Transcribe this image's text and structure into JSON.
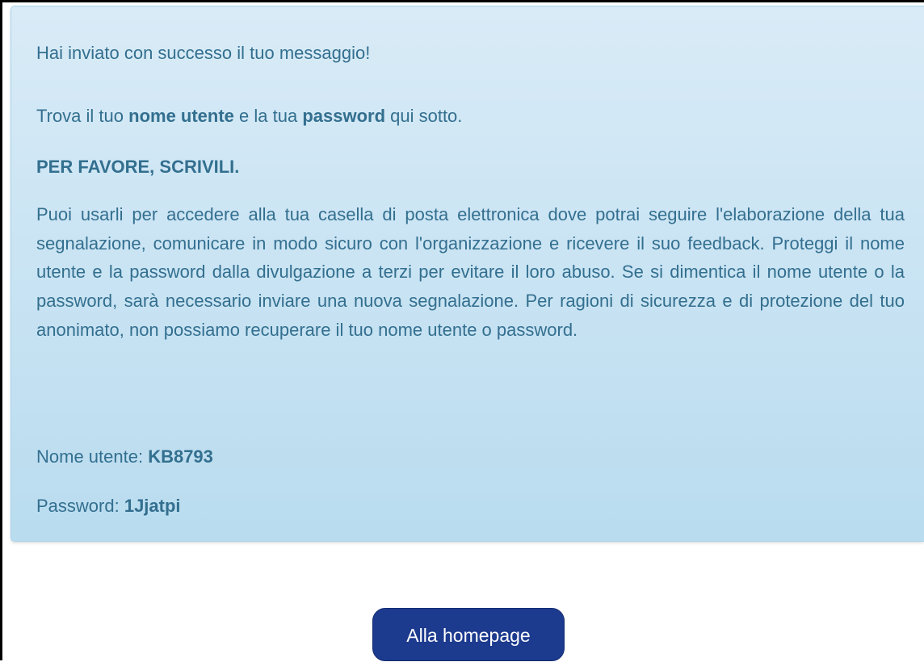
{
  "alert": {
    "success_message": "Hai inviato con successo il tuo messaggio!",
    "find_prefix": "Trova il tuo ",
    "find_username_bold": "nome utente",
    "find_middle": " e la tua ",
    "find_password_bold": "password",
    "find_suffix": " qui sotto.",
    "warning_heading": "PER FAVORE, SCRIVILI.",
    "explanation": "Puoi usarli per accedere alla tua casella di posta elettronica dove potrai seguire l'elaborazione della tua segnalazione, comunicare in modo sicuro con l'organizzazione e ricevere il suo feedback. Proteggi il nome utente e la password dalla divulgazione a terzi per evitare il loro abuso. Se si dimentica il nome utente o la password, sarà necessario inviare una nuova segnalazione. Per ragioni di sicurezza e di protezione del tuo anonimato, non possiamo recuperare il tuo nome utente o password.",
    "username_label": "Nome utente: ",
    "username_value": "KB8793",
    "password_label": "Password: ",
    "password_value": "1Jjatpi"
  },
  "actions": {
    "home_button_label": "Alla homepage"
  },
  "colors": {
    "alert_text": "#336f8f",
    "alert_bg_top": "#d9ebf7",
    "alert_bg_bottom": "#b9dcef",
    "button_bg": "#1c3a8e",
    "button_text": "#ffffff"
  }
}
